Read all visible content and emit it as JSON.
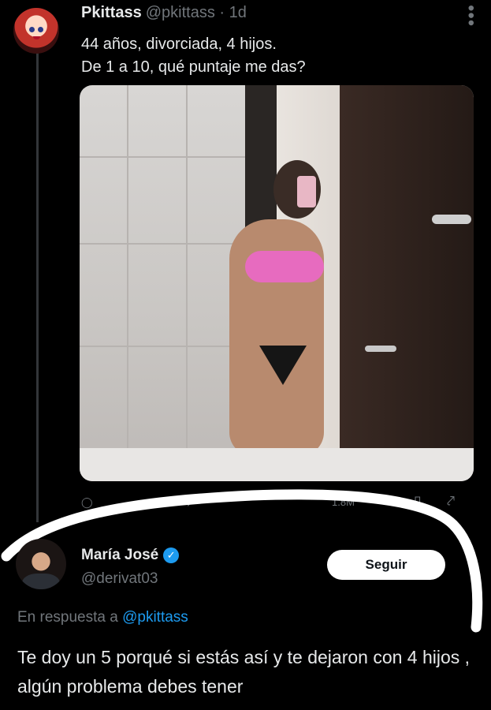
{
  "tweet": {
    "display_name": "Pkittass",
    "handle_time": "@pkittass · 1d",
    "line1": "44 años, divorciada, 4 hijos.",
    "line2": "De 1 a 10, qué puntaje me das?",
    "more_icon": "more-vertical-icon"
  },
  "actions": {
    "reply_icon": "reply-icon",
    "retweet_icon": "retweet-icon",
    "views_icon": "views-icon",
    "bookmark_icon": "bookmark-icon",
    "share_icon": "share-icon",
    "views_label": "1.8M"
  },
  "reply": {
    "display_name": "María José",
    "handle": "@derivat03",
    "follow_label": "Seguir",
    "in_reply_prefix": "En respuesta a ",
    "in_reply_mention": "@pkittass",
    "text": "Te doy un 5 porqué si estás así y te dejaron con 4 hijos , algún problema debes tener"
  },
  "colors": {
    "background": "#000000",
    "text_primary": "#e7e9ea",
    "text_secondary": "#71767b",
    "accent": "#1d9bf0",
    "scribble": "#ffffff"
  }
}
